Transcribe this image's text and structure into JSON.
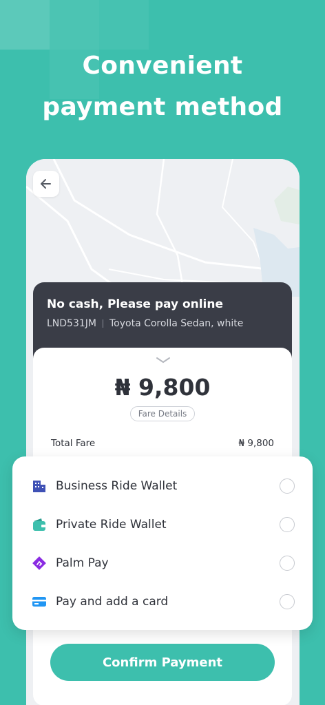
{
  "headline": {
    "line1": "Convenient",
    "line2": "payment method"
  },
  "map": {
    "back_icon": "arrow-left-icon"
  },
  "trip": {
    "title": "No cash, Please pay online",
    "plate": "LND531JM",
    "vehicle": "Toyota Corolla Sedan, white"
  },
  "fare": {
    "amount": "₦ 9,800",
    "details_label": "Fare Details",
    "total_label": "Total Fare",
    "total_value": "₦ 9,800"
  },
  "payment_methods": [
    {
      "label": "Business Ride Wallet",
      "icon": "building-icon",
      "color": "#3f51b5"
    },
    {
      "label": "Private Ride Wallet",
      "icon": "wallet-icon",
      "color": "#3dbfad"
    },
    {
      "label": "Palm Pay",
      "icon": "palmpay-icon",
      "color": "#8a2be2"
    },
    {
      "label": "Pay and add a card",
      "icon": "credit-card-icon",
      "color": "#2196f3"
    }
  ],
  "confirm_label": "Confirm Payment",
  "colors": {
    "background": "#3dbfad",
    "accent": "#3dbfad",
    "dark_card": "#3a3d47"
  }
}
